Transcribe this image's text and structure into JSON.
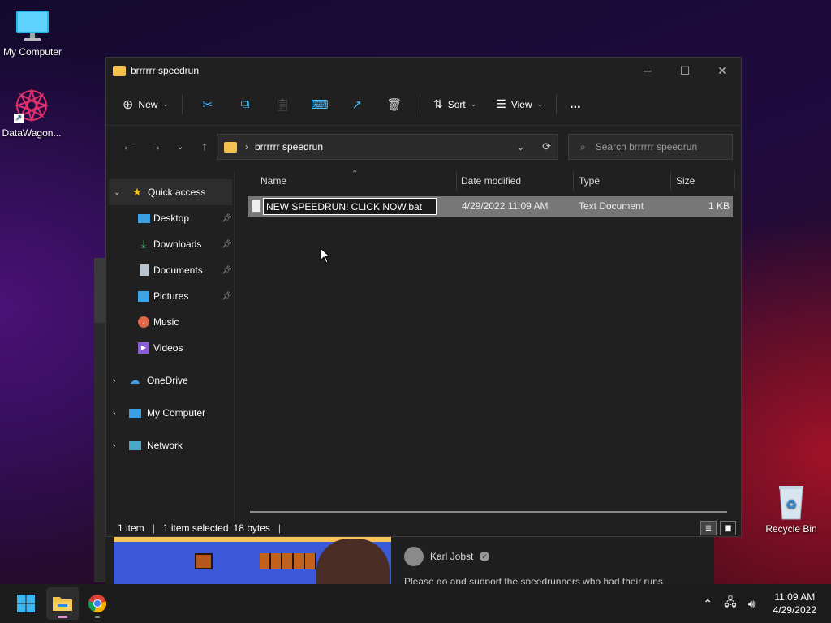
{
  "desktop": {
    "icons": [
      {
        "label": "My Computer"
      },
      {
        "label": "DataWagon..."
      },
      {
        "label": "Recycle Bin"
      }
    ]
  },
  "background_browser": {
    "channel_name": "Karl Jobst",
    "description": "Please go and support the speedrunners who had their runs"
  },
  "explorer": {
    "title": "brrrrrr speedrun",
    "toolbar": {
      "new_label": "New",
      "sort_label": "Sort",
      "view_label": "View",
      "more_label": "..."
    },
    "address": {
      "crumb": "brrrrrr speedrun"
    },
    "search": {
      "placeholder": "Search brrrrrr speedrun"
    },
    "sidebar": {
      "items": [
        {
          "label": "Quick access"
        },
        {
          "label": "Desktop"
        },
        {
          "label": "Downloads"
        },
        {
          "label": "Documents"
        },
        {
          "label": "Pictures"
        },
        {
          "label": "Music"
        },
        {
          "label": "Videos"
        },
        {
          "label": "OneDrive"
        },
        {
          "label": "My Computer"
        },
        {
          "label": "Network"
        }
      ]
    },
    "columns": {
      "name": "Name",
      "date": "Date modified",
      "type": "Type",
      "size": "Size"
    },
    "files": [
      {
        "name": "NEW SPEEDRUN! CLICK NOW.bat",
        "date": "4/29/2022 11:09 AM",
        "type": "Text Document",
        "size": "1 KB"
      }
    ],
    "status": {
      "count": "1 item",
      "selected": "1 item selected",
      "bytes": "18 bytes"
    }
  },
  "taskbar": {
    "time": "11:09 AM",
    "date": "4/29/2022"
  },
  "colors": {
    "accent": "#4cc2ff",
    "window_bg": "#202020",
    "taskbar_bg": "#1c1c1c",
    "selection": "#777777"
  }
}
